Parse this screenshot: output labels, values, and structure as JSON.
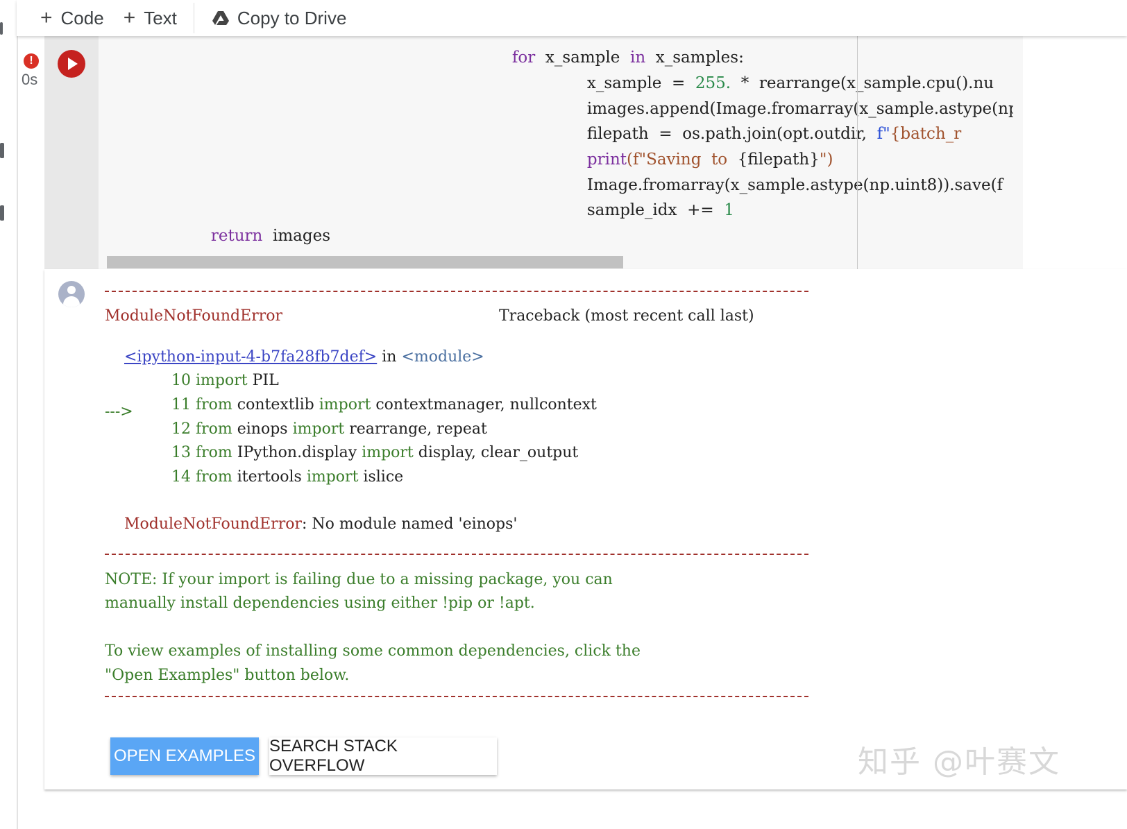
{
  "toolbar": {
    "code_label": "Code",
    "text_label": "Text",
    "drive_label": "Copy to Drive"
  },
  "cell": {
    "exec_time": "0s",
    "error_indicator": "!",
    "code_lines": {
      "l1": [
        "for",
        "x_sample",
        "in",
        "x_samples:"
      ],
      "l2": [
        "x_sample",
        "=",
        "255.",
        "*",
        "rearrange(x_sample.cpu().nu"
      ],
      "l3": "images.append(Image.fromarray(x_sample.astype(np.",
      "l4": [
        "filepath",
        "=",
        "os.path.join(opt.outdir,",
        "f\"",
        "{batch_r"
      ],
      "l5": [
        "print",
        "(f\"Saving",
        "to",
        "{filepath}",
        "\")"
      ],
      "l6": "Image.fromarray(x_sample.astype(np.uint8)).save(f",
      "l7": [
        "sample_idx",
        "+=",
        "1"
      ],
      "l8": [
        "return",
        "images"
      ]
    }
  },
  "output": {
    "error_name": "ModuleNotFoundError",
    "traceback_header": "Traceback (most recent call last)",
    "input_link": "<ipython-input-4-b7fa28fb7def>",
    "in_text": "in",
    "module_text": "<module>",
    "lines": [
      {
        "marker": "",
        "num": "10",
        "kw1": "import",
        "rest": "PIL"
      },
      {
        "marker": "",
        "num": "11",
        "kw1": "from",
        "mid": "contextlib",
        "kw2": "import",
        "rest": "contextmanager, nullcontext"
      },
      {
        "marker": "--->",
        "num": "12",
        "kw1": "from",
        "mid": "einops",
        "kw2": "import",
        "rest": "rearrange, repeat"
      },
      {
        "marker": "",
        "num": "13",
        "kw1": "from",
        "mid": "IPython.display",
        "kw2": "import",
        "rest": "display, clear_output"
      },
      {
        "marker": "",
        "num": "14",
        "kw1": "from",
        "mid": "itertools",
        "kw2": "import",
        "rest": "islice"
      }
    ],
    "error_message_name": "ModuleNotFoundError",
    "error_message": ": No module named 'einops'",
    "note_line1": "NOTE: If your import is failing due to a missing package, you can",
    "note_line2": "manually install dependencies using either !pip or !apt.",
    "note_line3": "To view examples of installing some common dependencies, click the",
    "note_line4": "\"Open Examples\" button below.",
    "open_examples_label": "OPEN EXAMPLES",
    "search_so_label": "SEARCH STACK OVERFLOW"
  },
  "watermark": "知乎 @叶赛文",
  "colors": {
    "run_button": "#c5221f",
    "primary_button": "#5aa6f5",
    "error_text": "#a0312c",
    "note_text": "#3a7d2a"
  }
}
